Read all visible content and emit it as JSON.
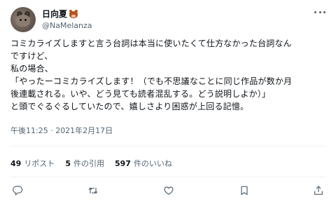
{
  "author": {
    "display_name": "日向夏",
    "handle": "@NaMelanza",
    "name_emoji_icon": "boar-face-icon"
  },
  "tweet": {
    "lines": [
      "コミカライズしますと言う台詞は本当に使いたくて仕方なかった台詞なん",
      "ですけど、",
      "私の場合、",
      "「やったーコミカライズします！（でも不思議なことに同じ作品が数か月",
      "後連載される。いや、どう見ても読者混乱する。どう説明しよか）」",
      "と頭でぐるぐるしていたので、嬉しさより困惑が上回る記憶。"
    ],
    "timestamp": "午後11:25 · 2021年2月17日"
  },
  "stats": [
    {
      "count": "49",
      "label": "リポスト"
    },
    {
      "count": "5",
      "label": "件の引用"
    },
    {
      "count": "597",
      "label": "件のいいね"
    }
  ],
  "actions": [
    {
      "name": "reply",
      "icon": "reply-icon"
    },
    {
      "name": "repost",
      "icon": "repost-icon"
    },
    {
      "name": "like",
      "icon": "heart-icon"
    },
    {
      "name": "bookmark",
      "icon": "bookmark-icon"
    },
    {
      "name": "share",
      "icon": "share-icon"
    }
  ],
  "colors": {
    "text": "#0f1419",
    "secondary": "#536471",
    "divider": "#eff3f4"
  }
}
